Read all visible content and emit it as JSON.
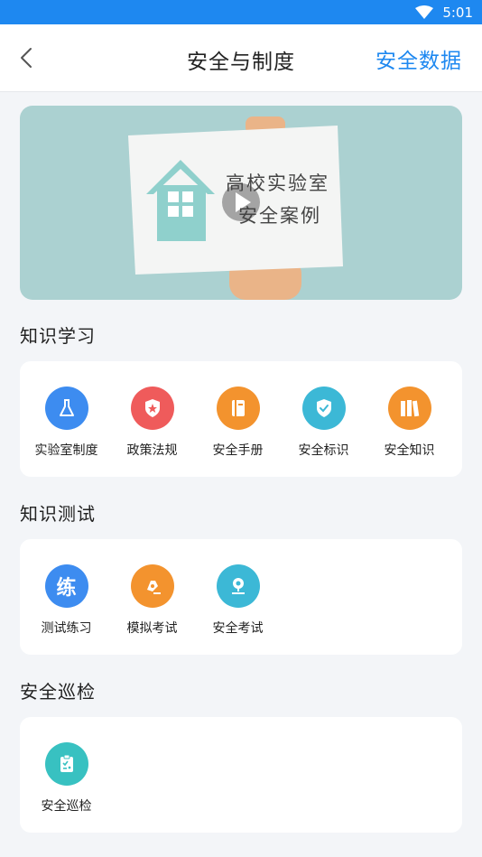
{
  "status_bar": {
    "time": "5:01",
    "wifi_icon": "wifi-icon"
  },
  "nav": {
    "back_icon": "chevron-left-icon",
    "title": "安全与制度",
    "right_link": "安全数据"
  },
  "banner": {
    "line1": "高校实验室",
    "line2": "安全案例",
    "play_icon": "play-icon",
    "colors": {
      "bg": "#abd1d1",
      "house": "#8fd0cc"
    }
  },
  "sections": [
    {
      "title": "知识学习",
      "items": [
        {
          "label": "实验室制度",
          "icon": "flask-icon",
          "color": "#3d8cf0"
        },
        {
          "label": "政策法规",
          "icon": "shield-star-icon",
          "color": "#ef5b5b"
        },
        {
          "label": "安全手册",
          "icon": "book-icon",
          "color": "#f3932e"
        },
        {
          "label": "安全标识",
          "icon": "shield-check-icon",
          "color": "#3cb8d6"
        },
        {
          "label": "安全知识",
          "icon": "bookshelf-icon",
          "color": "#f3932e"
        }
      ]
    },
    {
      "title": "知识测试",
      "items": [
        {
          "label": "测试练习",
          "icon": "practice-icon",
          "color": "#3d8cf0",
          "glyph": "练"
        },
        {
          "label": "模拟考试",
          "icon": "pen-icon",
          "color": "#f3932e"
        },
        {
          "label": "安全考试",
          "icon": "stamp-icon",
          "color": "#3cb8d6"
        }
      ]
    },
    {
      "title": "安全巡检",
      "items": [
        {
          "label": "安全巡检",
          "icon": "clipboard-check-icon",
          "color": "#38c1c1"
        }
      ]
    }
  ]
}
